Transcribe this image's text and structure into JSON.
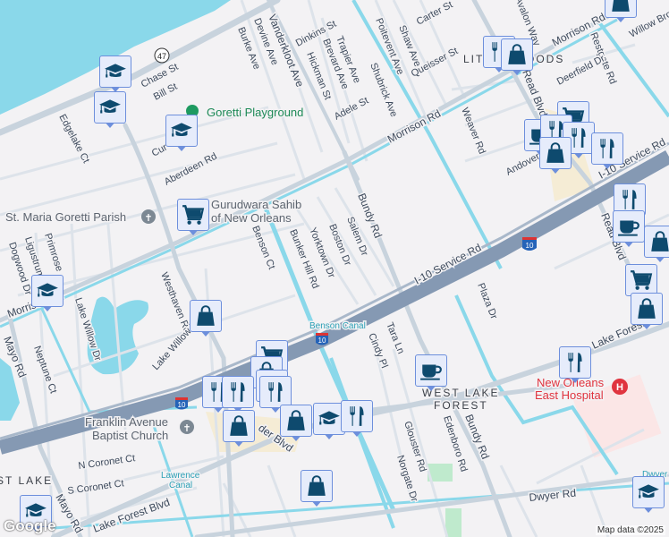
{
  "labels": {
    "vanderkloot": "Vanderkloot Ave",
    "devine": "Devine Ave",
    "burke": "Burke Ave",
    "dinkins": "Dinkins St",
    "brevard": "Brevard Ave",
    "hickman": "Hickman St",
    "trapier": "Trapier Ave",
    "shubrick": "Shubrick Ave",
    "adele": "Adele St",
    "poitevent": "Poitevent Ave",
    "shaw": "Shaw Ave",
    "carter": "Carter St",
    "queisser": "Queisser St",
    "avalon": "Avalon Way",
    "morrison1": "Morrison Rd",
    "morrison2": "Morrison Rd",
    "morrison3": "Morrison Rd",
    "restgate": "Restgate Rd",
    "deerfield": "Deerfield Dr",
    "willow": "Willow Brook",
    "weaver": "Weaver Rd",
    "read1": "Read Blvd",
    "read2": "Read Blvd",
    "andover": "Andover",
    "chase": "Chase St",
    "bill": "Bill St",
    "edgelake": "Edgelake Ct",
    "aberdeen": "Aberdeen Rd",
    "cur": "Cur",
    "bundy1": "Bundy Rd",
    "bundy2": "Bundy Rd",
    "salem": "Salem Dr",
    "boston": "Boston Dr",
    "yorktown": "Yorktown Dr",
    "bunker": "Bunker Hill Rd",
    "benson": "Benson Ct",
    "i10sr": "I-10 Service Rd",
    "i10sr2": "I-10 Service Rd",
    "westhaven": "Westhaven Rd",
    "lakewillow": "Lake Willow Dr",
    "lakewillowdr": "Lake Willow Dr",
    "primrose": "Primrose",
    "ligustrum": "Ligustrum",
    "dogwood": "Dogwood Dr",
    "mayo1": "Mayo Rd",
    "mayo2": "Mayo Rd",
    "neptune": "Neptune Ct",
    "ncoronet": "N Coronet Ct",
    "scoronet": "S Coronet Ct",
    "lakeforest1": "Lake Forest Blvd",
    "lakeforest2": "Lake Forest",
    "dwyer": "Dwyer Rd",
    "cindy": "Cindy Pl",
    "tara": "Tara Ln",
    "plaza": "Plaza Dr",
    "glouster": "Glouster Rd",
    "norgate": "Norgate Dr",
    "edenboro": "Edenboro Rd",
    "morr": "Morris",
    "readerblvd": "der Blvd",
    "lake_short": "La"
  },
  "places": {
    "goretti_playground": "Goretti Playground",
    "st_maria": "St. Maria Goretti Parish",
    "gurudwara1": "Gurudwara Sahib",
    "gurudwara2": "of New Orleans",
    "franklin1": "Franklin Avenue",
    "franklin2": "Baptist Church",
    "hospital1": "New Orleans",
    "hospital2": "East Hospital",
    "little_woods": "LITTLE WOODS",
    "west_lake_forest1": "WEST LAKE",
    "west_lake_forest2": "FOREST",
    "west_lake": "ST LAKE",
    "benson_canal": "Benson Canal",
    "lawrence1": "Lawrence",
    "lawrence2": "Canal",
    "dwyer_canal": "Dwyer"
  },
  "shields": {
    "la47": "47",
    "i10a": "10",
    "i10b": "10",
    "i10c": "10"
  },
  "markers": [
    {
      "icon": "school"
    },
    {
      "icon": "school"
    },
    {
      "icon": "school"
    },
    {
      "icon": "school"
    },
    {
      "icon": "school"
    },
    {
      "icon": "school"
    },
    {
      "icon": "school"
    },
    {
      "icon": "cart"
    },
    {
      "icon": "cart"
    },
    {
      "icon": "cart"
    },
    {
      "icon": "cart"
    },
    {
      "icon": "restaurant"
    },
    {
      "icon": "bag"
    },
    {
      "icon": "cup"
    },
    {
      "icon": "restaurant"
    },
    {
      "icon": "restaurant"
    },
    {
      "icon": "bag"
    },
    {
      "icon": "restaurant"
    },
    {
      "icon": "restaurant"
    },
    {
      "icon": "cup"
    },
    {
      "icon": "bag"
    },
    {
      "icon": "bag"
    },
    {
      "icon": "bag"
    },
    {
      "icon": "bag"
    },
    {
      "icon": "restaurant"
    },
    {
      "icon": "restaurant"
    },
    {
      "icon": "restaurant"
    },
    {
      "icon": "restaurant"
    },
    {
      "icon": "bag"
    },
    {
      "icon": "bag"
    },
    {
      "icon": "restaurant"
    },
    {
      "icon": "bag"
    },
    {
      "icon": "cup"
    },
    {
      "icon": "restaurant"
    },
    {
      "icon": "bag"
    }
  ],
  "footer": {
    "logo": "Google",
    "attribution": "Map data ©2025"
  },
  "colors": {
    "water": "#8ad8ea",
    "road": "#c8d3dd",
    "highway": "#8599b3",
    "marker_fill": "#e6ecfb",
    "marker_icon": "#0e4a6e",
    "hospital": "#e0343f",
    "park": "#1e9a60"
  }
}
